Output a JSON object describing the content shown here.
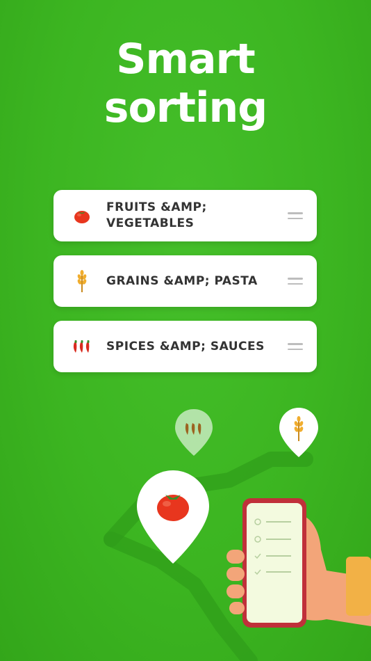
{
  "headline": {
    "line1": "Smart",
    "line2": "sorting"
  },
  "categories": [
    {
      "label": "FRUITS &AMP; VEGETABLES",
      "icon": "tomato-icon"
    },
    {
      "label": "GRAINS &AMP; PASTA",
      "icon": "wheat-icon"
    },
    {
      "label": "SPICES &AMP; SAUCES",
      "icon": "chili-peppers-icon"
    }
  ],
  "colors": {
    "background": "#3cb521",
    "card": "#ffffff",
    "text": "#333333",
    "tomato": "#e8361e",
    "phone": "#c0303a"
  }
}
